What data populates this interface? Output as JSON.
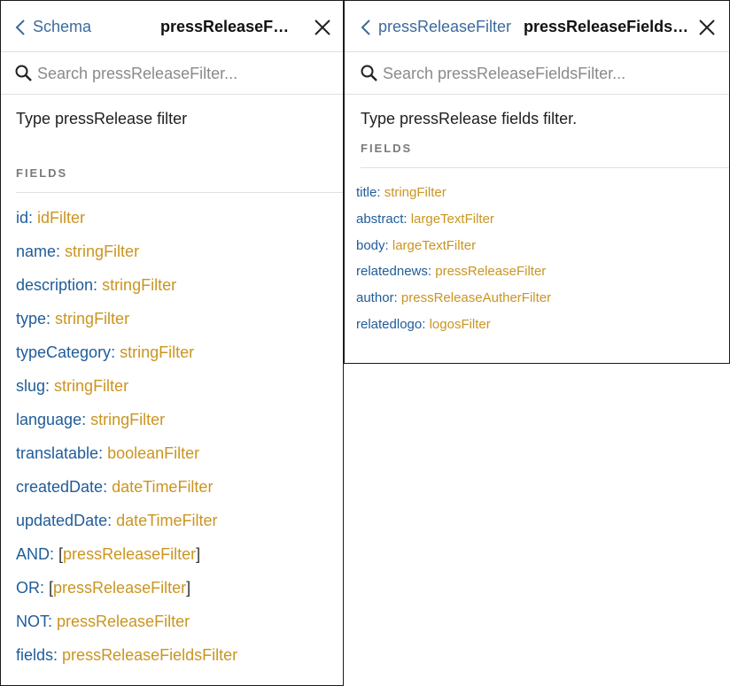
{
  "left_panel": {
    "back_label": "Schema",
    "title": "pressReleaseFilter",
    "search_placeholder": "Search pressReleaseFilter...",
    "description": "Type pressRelease filter",
    "section_title": "FIELDS",
    "fields": [
      {
        "name": "id",
        "type": "idFilter",
        "list": false
      },
      {
        "name": "name",
        "type": "stringFilter",
        "list": false
      },
      {
        "name": "description",
        "type": "stringFilter",
        "list": false
      },
      {
        "name": "type",
        "type": "stringFilter",
        "list": false
      },
      {
        "name": "typeCategory",
        "type": "stringFilter",
        "list": false
      },
      {
        "name": "slug",
        "type": "stringFilter",
        "list": false
      },
      {
        "name": "language",
        "type": "stringFilter",
        "list": false
      },
      {
        "name": "translatable",
        "type": "booleanFilter",
        "list": false
      },
      {
        "name": "createdDate",
        "type": "dateTimeFilter",
        "list": false
      },
      {
        "name": "updatedDate",
        "type": "dateTimeFilter",
        "list": false
      },
      {
        "name": "AND",
        "type": "pressReleaseFilter",
        "list": true
      },
      {
        "name": "OR",
        "type": "pressReleaseFilter",
        "list": true
      },
      {
        "name": "NOT",
        "type": "pressReleaseFilter",
        "list": false
      },
      {
        "name": "fields",
        "type": "pressReleaseFieldsFilter",
        "list": false
      }
    ]
  },
  "right_panel": {
    "back_label": "pressReleaseFilter",
    "title": "pressReleaseFieldsFi...",
    "search_placeholder": "Search pressReleaseFieldsFilter...",
    "description": "Type pressRelease fields filter.",
    "section_title": "FIELDS",
    "fields": [
      {
        "name": "title",
        "type": "stringFilter",
        "list": false
      },
      {
        "name": "abstract",
        "type": "largeTextFilter",
        "list": false
      },
      {
        "name": "body",
        "type": "largeTextFilter",
        "list": false
      },
      {
        "name": "relatednews",
        "type": "pressReleaseFilter",
        "list": false
      },
      {
        "name": "author",
        "type": "pressReleaseAutherFilter",
        "list": false
      },
      {
        "name": "relatedlogo",
        "type": "logosFilter",
        "list": false
      }
    ]
  },
  "colors": {
    "field_name": "#1f5c99",
    "field_type": "#ca9520",
    "back_link": "#3d6a9c",
    "section_title": "#7a7a7a"
  },
  "icons": {
    "back": "chevron-left-icon",
    "close": "close-icon",
    "search": "search-icon"
  }
}
